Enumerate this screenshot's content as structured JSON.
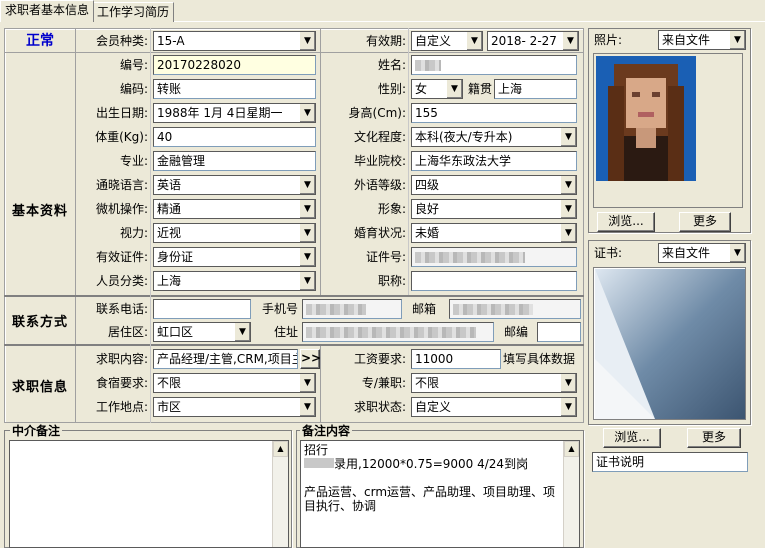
{
  "tabs": [
    "求职者基本信息",
    "工作学习简历"
  ],
  "status": {
    "label": "正常",
    "color": "#0000cc"
  },
  "membership": {
    "label": "会员种类:",
    "value": "15-A"
  },
  "validity": {
    "label": "有效期:",
    "type": "自定义",
    "date": "2018- 2-27"
  },
  "sections": {
    "basic": "基本资料",
    "contact": "联系方式",
    "job": "求职信息"
  },
  "basic": {
    "id_label": "编号:",
    "id_value": "20170228020",
    "name_label": "姓名:",
    "code_label": "编码:",
    "code_value": "转账",
    "gender_label": "性别:",
    "gender_value": "女",
    "native_label": "籍贯",
    "native_value": "上海",
    "birth_label": "出生日期:",
    "birth_value": "1988年 1月 4日星期一",
    "height_label": "身高(Cm):",
    "height_value": "155",
    "weight_label": "体重(Kg):",
    "weight_value": "40",
    "edu_label": "文化程度:",
    "edu_value": "本科(夜大/专升本)",
    "major_label": "专业:",
    "major_value": "金融管理",
    "school_label": "毕业院校:",
    "school_value": "上海华东政法大学",
    "lang_label": "通晓语言:",
    "lang_value": "英语",
    "langlevel_label": "外语等级:",
    "langlevel_value": "四级",
    "pc_label": "微机操作:",
    "pc_value": "精通",
    "image_label": "形象:",
    "image_value": "良好",
    "vision_label": "视力:",
    "vision_value": "近视",
    "marital_label": "婚育状况:",
    "marital_value": "未婚",
    "cert_type_label": "有效证件:",
    "cert_type_value": "身份证",
    "cert_no_label": "证件号:",
    "category_label": "人员分类:",
    "category_value": "上海",
    "title_label": "职称:"
  },
  "contact": {
    "phone_label": "联系电话:",
    "mobile_label": "手机号",
    "email_label": "邮箱",
    "district_label": "居住区:",
    "district_value": "虹口区",
    "address_label": "住址",
    "zip_label": "邮编"
  },
  "job": {
    "content_label": "求职内容:",
    "content_value": "产品经理/主管,CRM,项目主",
    "more_button": ">>",
    "salary_label": "工资要求:",
    "salary_value": "11000",
    "salary_hint": "填写具体数据",
    "board_label": "食宿要求:",
    "board_value": "不限",
    "parttime_label": "专/兼职:",
    "parttime_value": "不限",
    "location_label": "工作地点:",
    "location_value": "市区",
    "state_label": "求职状态:",
    "state_value": "自定义"
  },
  "photo": {
    "label": "照片:",
    "source": "来自文件",
    "browse": "浏览...",
    "more": "更多"
  },
  "certificate": {
    "label": "证书:",
    "source": "来自文件",
    "browse": "浏览...",
    "more": "更多",
    "desc": "证书说明"
  },
  "agent_note": {
    "title": "中介备注",
    "text": ""
  },
  "remark": {
    "title": "备注内容",
    "line1": "招行",
    "line2": "录用,12000*0.75=9000 4/24到岗",
    "line3": "",
    "line4": "产品运营、crm运营、产品助理、项目助理、项目执行、协调"
  }
}
